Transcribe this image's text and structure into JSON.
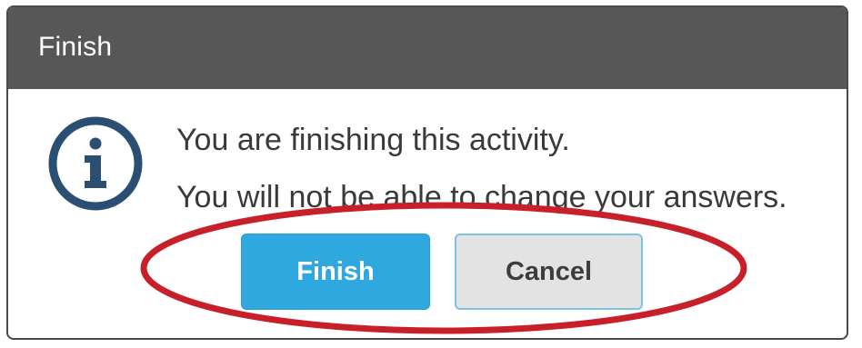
{
  "dialog": {
    "title": "Finish",
    "message_line1": "You are finishing this activity.",
    "message_line2": "You will not be able to change your answers.",
    "icon": "info-icon"
  },
  "buttons": {
    "finish_label": "Finish",
    "cancel_label": "Cancel"
  },
  "colors": {
    "titlebar": "#575757",
    "finish_button": "#2ea8de",
    "cancel_button": "#e3e3e3",
    "icon": "#2b4f72",
    "highlight_ellipse": "#c8202a"
  }
}
